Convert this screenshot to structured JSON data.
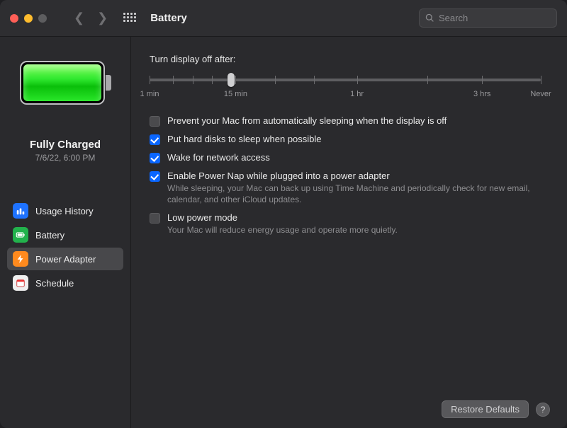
{
  "header": {
    "title": "Battery",
    "search_placeholder": "Search"
  },
  "sidebar": {
    "status_title": "Fully Charged",
    "status_sub": "7/6/22, 6:00 PM",
    "items": [
      {
        "label": "Usage History"
      },
      {
        "label": "Battery"
      },
      {
        "label": "Power Adapter"
      },
      {
        "label": "Schedule"
      }
    ]
  },
  "main": {
    "slider_label": "Turn display off after:",
    "slider_ticks": [
      "1 min",
      "15 min",
      "1 hr",
      "3 hrs",
      "Never"
    ],
    "options": [
      {
        "checked": false,
        "label": "Prevent your Mac from automatically sleeping when the display is off"
      },
      {
        "checked": true,
        "label": "Put hard disks to sleep when possible"
      },
      {
        "checked": true,
        "label": "Wake for network access"
      },
      {
        "checked": true,
        "label": "Enable Power Nap while plugged into a power adapter",
        "desc": "While sleeping, your Mac can back up using Time Machine and periodically check for new email, calendar, and other iCloud updates."
      },
      {
        "checked": false,
        "label": "Low power mode",
        "desc": "Your Mac will reduce energy usage and operate more quietly."
      }
    ],
    "restore_label": "Restore Defaults",
    "help_label": "?"
  }
}
